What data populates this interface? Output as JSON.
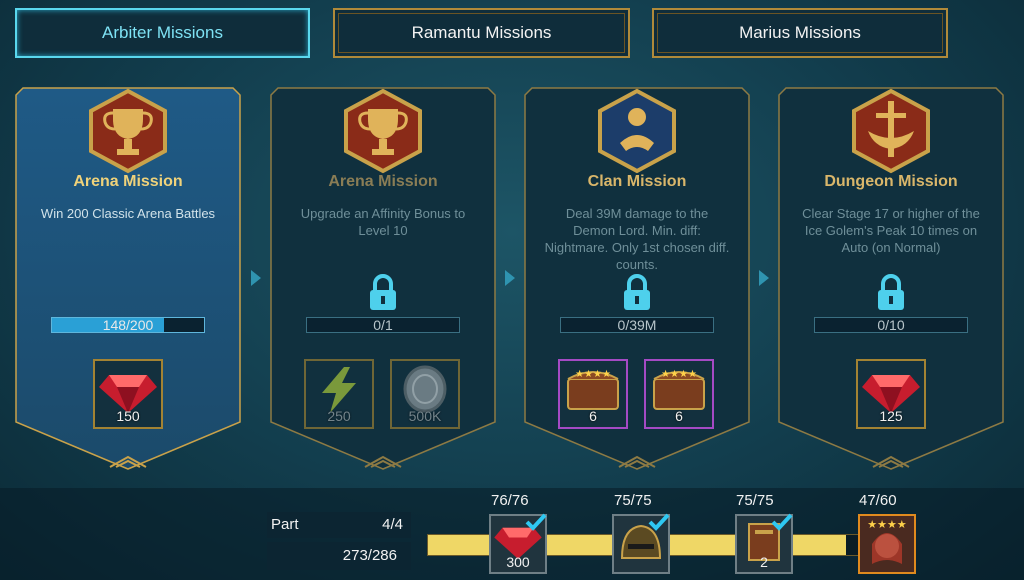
{
  "tabs": [
    {
      "label": "Arbiter Missions",
      "active": true
    },
    {
      "label": "Ramantu Missions",
      "active": false
    },
    {
      "label": "Marius Missions",
      "active": false
    }
  ],
  "missions": [
    {
      "title": "Arena Mission",
      "description": "Win 200 Classic Arena Battles",
      "progress_text": "148/200",
      "progress_fraction": 0.74,
      "locked": false,
      "rewards": [
        {
          "icon": "ruby-gem-icon",
          "amount": "150"
        }
      ]
    },
    {
      "title": "Arena Mission",
      "description": "Upgrade an Affinity Bonus to Level 10",
      "progress_text": "0/1",
      "progress_fraction": 0,
      "locked": true,
      "rewards": [
        {
          "icon": "energy-bolt-icon",
          "amount": "250"
        },
        {
          "icon": "silver-coin-icon",
          "amount": "500K"
        }
      ]
    },
    {
      "title": "Clan Mission",
      "description": "Deal 39M damage to the Demon Lord. Min. diff: Nightmare. Only 1st chosen diff. counts.",
      "progress_text": "0/39M",
      "progress_fraction": 0,
      "locked": true,
      "rewards": [
        {
          "icon": "treasure-chest-icon",
          "amount": "6"
        },
        {
          "icon": "treasure-chest-icon",
          "amount": "6"
        }
      ]
    },
    {
      "title": "Dungeon Mission",
      "description": "Clear Stage 17 or higher of the Ice Golem's Peak 10 times on Auto (on Normal)",
      "progress_text": "0/10",
      "progress_fraction": 0,
      "locked": true,
      "rewards": [
        {
          "icon": "ruby-gem-icon",
          "amount": "125"
        }
      ]
    }
  ],
  "part": {
    "label": "Part",
    "value": "4/4",
    "total_progress": "273/286",
    "progress_fraction": 0.955
  },
  "milestones": [
    {
      "count": "76/76",
      "icon": "ruby-gem-icon",
      "amount": "300",
      "claimed": true
    },
    {
      "count": "75/75",
      "icon": "helmet-icon",
      "amount": "",
      "claimed": true
    },
    {
      "count": "75/75",
      "icon": "tome-icon",
      "amount": "2",
      "claimed": true
    },
    {
      "count": "47/60",
      "icon": "champion-portrait-icon",
      "amount": "",
      "claimed": false
    }
  ],
  "colors": {
    "accent": "#5ad8ee",
    "gold": "#b08a3a",
    "progress_yellow": "#efd766",
    "locked_text": "#6f8f99"
  }
}
